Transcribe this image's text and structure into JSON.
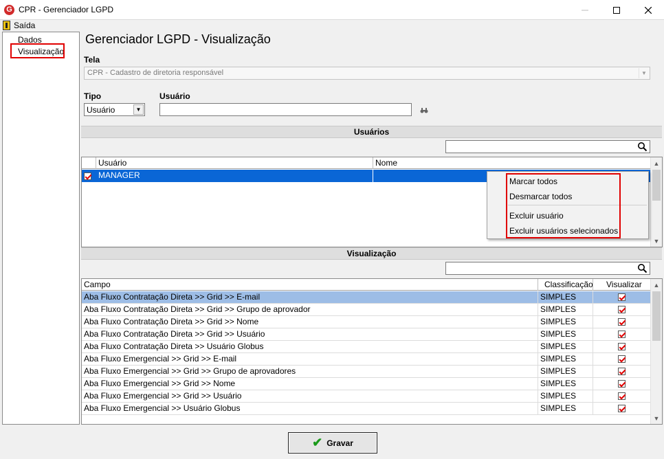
{
  "window": {
    "title": "CPR - Gerenciador LGPD",
    "app_icon": "G"
  },
  "menu": {
    "exit_label": "Saída"
  },
  "tree": {
    "items": [
      {
        "label": "Dados"
      },
      {
        "label": "Visualização"
      }
    ]
  },
  "page_title": "Gerenciador LGPD - Visualização",
  "tela": {
    "label": "Tela",
    "value": "CPR - Cadastro de diretoria responsável"
  },
  "tipo": {
    "label": "Tipo",
    "value": "Usuário"
  },
  "usuario_field": {
    "label": "Usuário",
    "value": ""
  },
  "usuarios_section": {
    "title": "Usuários",
    "search_value": "",
    "columns": [
      "Usuário",
      "Nome"
    ],
    "rows": [
      {
        "checked": true,
        "usuario": "MANAGER",
        "nome": ""
      }
    ]
  },
  "context_menu": {
    "items": [
      "Marcar todos",
      "Desmarcar todos",
      "Excluir usuário",
      "Excluir usuários selecionados"
    ]
  },
  "visualizacao_section": {
    "title": "Visualização",
    "search_value": "",
    "columns": [
      "Campo",
      "Classificação",
      "Visualizar"
    ],
    "rows": [
      {
        "campo": "Aba Fluxo Contratação Direta >> Grid >> E-mail",
        "classificacao": "SIMPLES",
        "visualizar": true
      },
      {
        "campo": "Aba Fluxo Contratação Direta >> Grid >> Grupo de aprovador",
        "classificacao": "SIMPLES",
        "visualizar": true
      },
      {
        "campo": "Aba Fluxo Contratação Direta >> Grid >> Nome",
        "classificacao": "SIMPLES",
        "visualizar": true
      },
      {
        "campo": "Aba Fluxo Contratação Direta >> Grid >> Usuário",
        "classificacao": "SIMPLES",
        "visualizar": true
      },
      {
        "campo": "Aba Fluxo Contratação Direta >> Usuário Globus",
        "classificacao": "SIMPLES",
        "visualizar": true
      },
      {
        "campo": "Aba Fluxo Emergencial >> Grid >> E-mail",
        "classificacao": "SIMPLES",
        "visualizar": true
      },
      {
        "campo": "Aba Fluxo Emergencial >> Grid >> Grupo de aprovadores",
        "classificacao": "SIMPLES",
        "visualizar": true
      },
      {
        "campo": "Aba Fluxo Emergencial >> Grid >> Nome",
        "classificacao": "SIMPLES",
        "visualizar": true
      },
      {
        "campo": "Aba Fluxo Emergencial >> Grid >> Usuário",
        "classificacao": "SIMPLES",
        "visualizar": true
      },
      {
        "campo": "Aba Fluxo Emergencial >> Usuário Globus",
        "classificacao": "SIMPLES",
        "visualizar": true
      }
    ]
  },
  "save_button": {
    "label": "Gravar"
  },
  "colors": {
    "selection": "#0a66d6",
    "row_highlight": "#9dbde6",
    "annotation_red": "#e00000",
    "save_icon": "#1a9a1a"
  }
}
